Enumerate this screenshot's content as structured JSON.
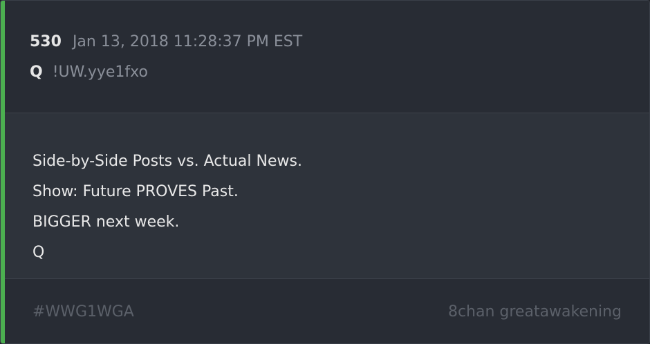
{
  "post": {
    "number": "530",
    "timestamp": "Jan 13, 2018 11:28:37 PM EST",
    "author": "Q",
    "tripcode": "!UW.yye1fxo",
    "lines": [
      "Side-by-Side Posts vs. Actual News.",
      "Show: Future PROVES Past.",
      "BIGGER next week.",
      "Q"
    ]
  },
  "footer": {
    "hashtag": "#WWG1WGA",
    "source": "8chan greatawakening"
  },
  "colors": {
    "accent": "#4caf50",
    "background": "#282c34",
    "body_background": "#2e333b"
  }
}
